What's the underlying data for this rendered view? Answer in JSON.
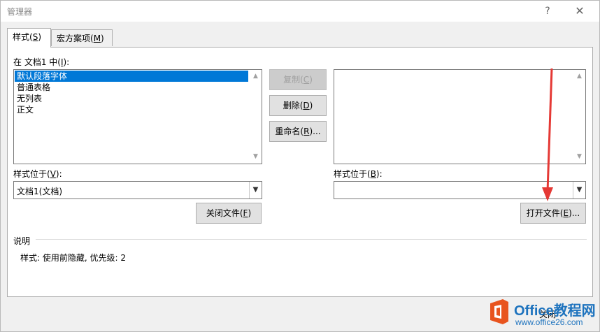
{
  "window": {
    "title": "管理器",
    "help_glyph": "?",
    "close_glyph": "✕"
  },
  "tabs": [
    {
      "pre": "样式(",
      "key": "S",
      "post": ")"
    },
    {
      "pre": "宏方案项(",
      "key": "M",
      "post": ")"
    }
  ],
  "left": {
    "list_label": {
      "pre": "在 文档1 中(",
      "key": "I",
      "post": "):"
    },
    "items": [
      "默认段落字体",
      "普通表格",
      "无列表",
      "正文"
    ],
    "selected_index": 0,
    "location_label": {
      "pre": "样式位于(",
      "key": "V",
      "post": "):"
    },
    "location_value": "文档1(文档)",
    "close_file_button": {
      "pre": "关闭文件(",
      "key": "F",
      "post": ")"
    }
  },
  "middle": {
    "copy_button": {
      "pre": "复制(",
      "key": "C",
      "post": ")"
    },
    "delete_button": {
      "pre": "删除(",
      "key": "D",
      "post": ")"
    },
    "rename_button": {
      "pre": "重命名(",
      "key": "R",
      "post": ")..."
    }
  },
  "right": {
    "location_label": {
      "pre": "样式位于(",
      "key": "B",
      "post": "):"
    },
    "location_value": "",
    "open_file_button": {
      "pre": "打开文件(",
      "key": "E",
      "post": ")..."
    }
  },
  "description": {
    "label": "说明",
    "text": "样式: 使用前隐藏, 优先级: 2"
  },
  "bottom": {
    "close_button_text": "关闭"
  },
  "watermark": {
    "brand": "Office教程网",
    "url": "www.office26.com"
  },
  "colors": {
    "selection": "#0078d7",
    "annotation_arrow": "#e53935",
    "watermark": "#1e73be",
    "watermark_logo": "#e8541e"
  }
}
